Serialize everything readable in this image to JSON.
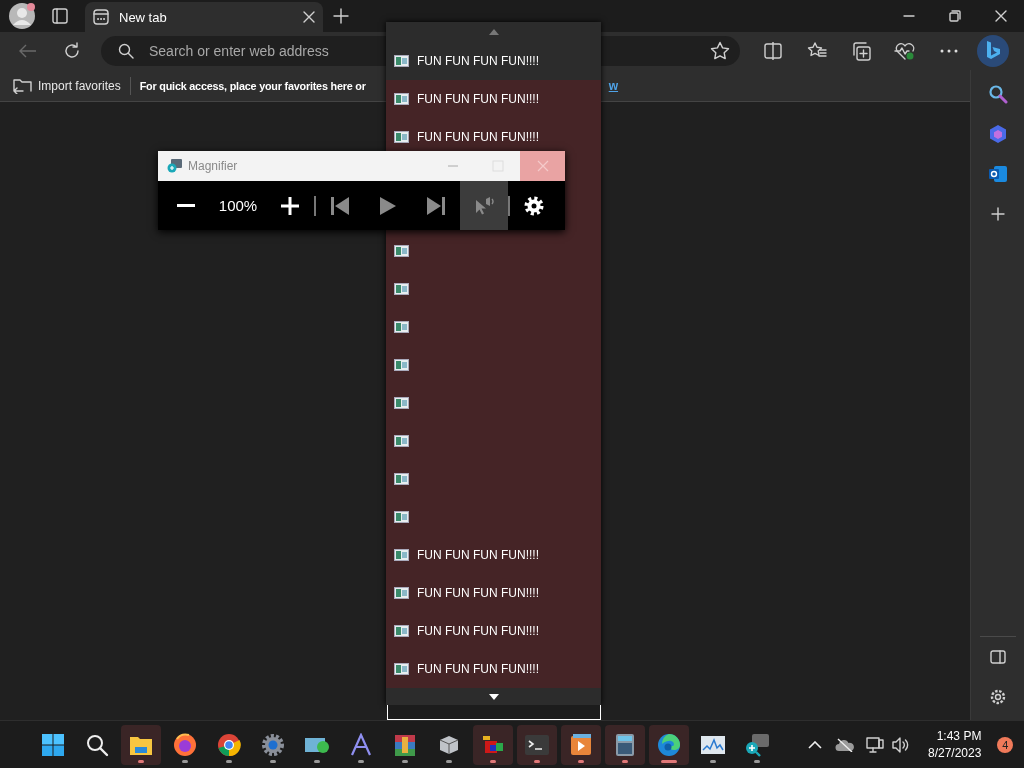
{
  "browser": {
    "tabs": [
      {
        "label": "New tab",
        "selected": true
      }
    ],
    "back_button": {
      "disabled": true
    },
    "address_bar": {
      "placeholder": "Search or enter web address"
    },
    "favorites_bar": {
      "import": "Import favorites",
      "hint": "For quick access, place your favorites here or",
      "link": "w"
    }
  },
  "dropdown": {
    "items": [
      {
        "label": "FUN FUN FUN FUN!!!!",
        "highlighted": true
      },
      {
        "label": "FUN FUN FUN FUN!!!!",
        "highlighted": false
      },
      {
        "label": "FUN FUN FUN FUN!!!!",
        "highlighted": false
      },
      {
        "highlighted": false
      },
      {
        "highlighted": false
      },
      {
        "highlighted": false
      },
      {
        "highlighted": false
      },
      {
        "highlighted": false
      },
      {
        "highlighted": false
      },
      {
        "highlighted": false
      },
      {
        "highlighted": false
      },
      {
        "label": "FUN FUN FUN FUN!!!!",
        "highlighted": false
      },
      {
        "label": "FUN FUN FUN FUN!!!!",
        "highlighted": false
      },
      {
        "label": "FUN FUN FUN FUN!!!!",
        "highlighted": false
      },
      {
        "label": "FUN FUN FUN FUN!!!!",
        "highlighted": false
      }
    ]
  },
  "magnifier": {
    "title": "Magnifier",
    "zoom": "100%",
    "playback_disabled": true,
    "read_pressed": true
  },
  "taskbar": {
    "apps": [
      {
        "kind": "start",
        "running": false,
        "highlighted": false,
        "focused": false
      },
      {
        "kind": "search",
        "running": false,
        "highlighted": false,
        "focused": false
      },
      {
        "kind": "folder",
        "running": true,
        "highlighted": true,
        "focused": false
      },
      {
        "kind": "firefox",
        "running": true,
        "highlighted": false,
        "focused": false
      },
      {
        "kind": "chrome",
        "running": true,
        "highlighted": false,
        "focused": false
      },
      {
        "kind": "settings",
        "running": true,
        "highlighted": false,
        "focused": false
      },
      {
        "kind": "transfer",
        "running": true,
        "highlighted": false,
        "focused": false
      },
      {
        "kind": "font",
        "running": true,
        "highlighted": false,
        "focused": false
      },
      {
        "kind": "archive",
        "running": true,
        "highlighted": false,
        "focused": false
      },
      {
        "kind": "cube",
        "running": true,
        "highlighted": false,
        "focused": false
      },
      {
        "kind": "paint",
        "running": true,
        "highlighted": true,
        "focused": false
      },
      {
        "kind": "terminal",
        "running": true,
        "highlighted": true,
        "focused": false
      },
      {
        "kind": "media",
        "running": true,
        "highlighted": true,
        "focused": false
      },
      {
        "kind": "calculator",
        "running": true,
        "highlighted": true,
        "focused": false
      },
      {
        "kind": "edge",
        "running": true,
        "highlighted": true,
        "focused": true
      },
      {
        "kind": "monitor",
        "running": true,
        "highlighted": false,
        "focused": false
      },
      {
        "kind": "magnifier",
        "running": true,
        "highlighted": false,
        "focused": false
      }
    ],
    "time": "1:43 PM",
    "date": "8/27/2023",
    "notifications": "4"
  }
}
